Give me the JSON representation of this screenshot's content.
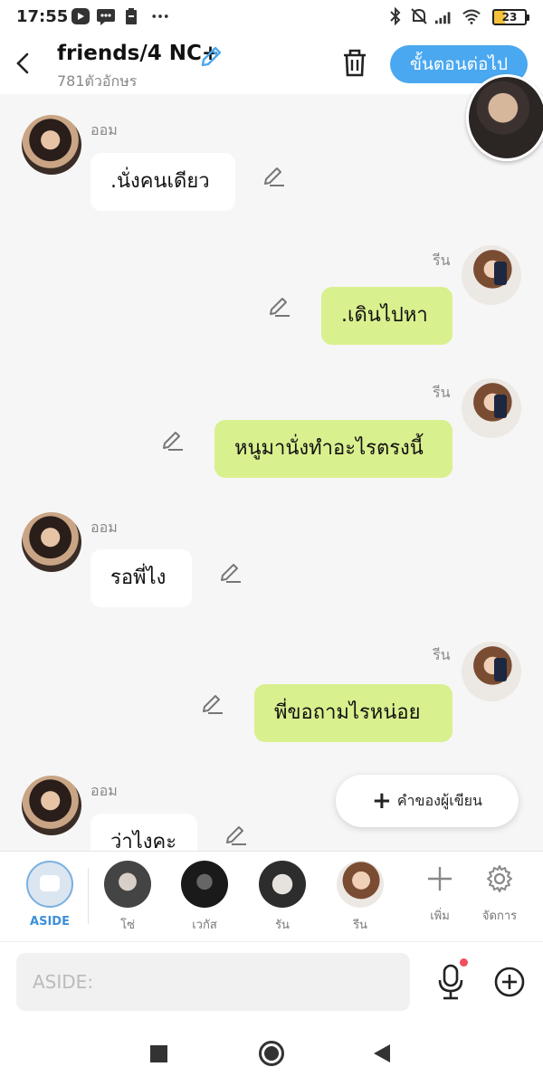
{
  "status_bar": {
    "time": "17:55",
    "battery": "23"
  },
  "header": {
    "title": "friends/4 NC+",
    "char_count": "781ตัวอักษร",
    "next_label": "ขั้นตอนต่อไป"
  },
  "messages": [
    {
      "speaker": "ออม",
      "text": ".นั่งคนเดียว",
      "side": "left"
    },
    {
      "speaker": "รีน",
      "text": ".เดินไปหา",
      "side": "right"
    },
    {
      "speaker": "รีน",
      "text": "หนูมานั่งทำอะไรตรงนี้",
      "side": "right"
    },
    {
      "speaker": "ออม",
      "text": "รอพี่ไง",
      "side": "left"
    },
    {
      "speaker": "รีน",
      "text": "พี่ขอถามไรหน่อย",
      "side": "right"
    },
    {
      "speaker": "ออม",
      "text": "ว่าไงคะ",
      "side": "left"
    }
  ],
  "writer_note_label": "คำของผู้เขียน",
  "characters": [
    {
      "name": "ASIDE"
    },
    {
      "name": "โซ่"
    },
    {
      "name": "เวกัส"
    },
    {
      "name": "รัน"
    },
    {
      "name": "รีน"
    }
  ],
  "tools": {
    "add_label": "เพิ่ม",
    "manage_label": "จัดการ"
  },
  "input": {
    "placeholder": "ASIDE:"
  },
  "colors": {
    "accent": "#4aa8f0",
    "right_bubble": "#d9f08e",
    "left_bubble": "#ffffff",
    "aside_label": "#3c8fd8"
  }
}
